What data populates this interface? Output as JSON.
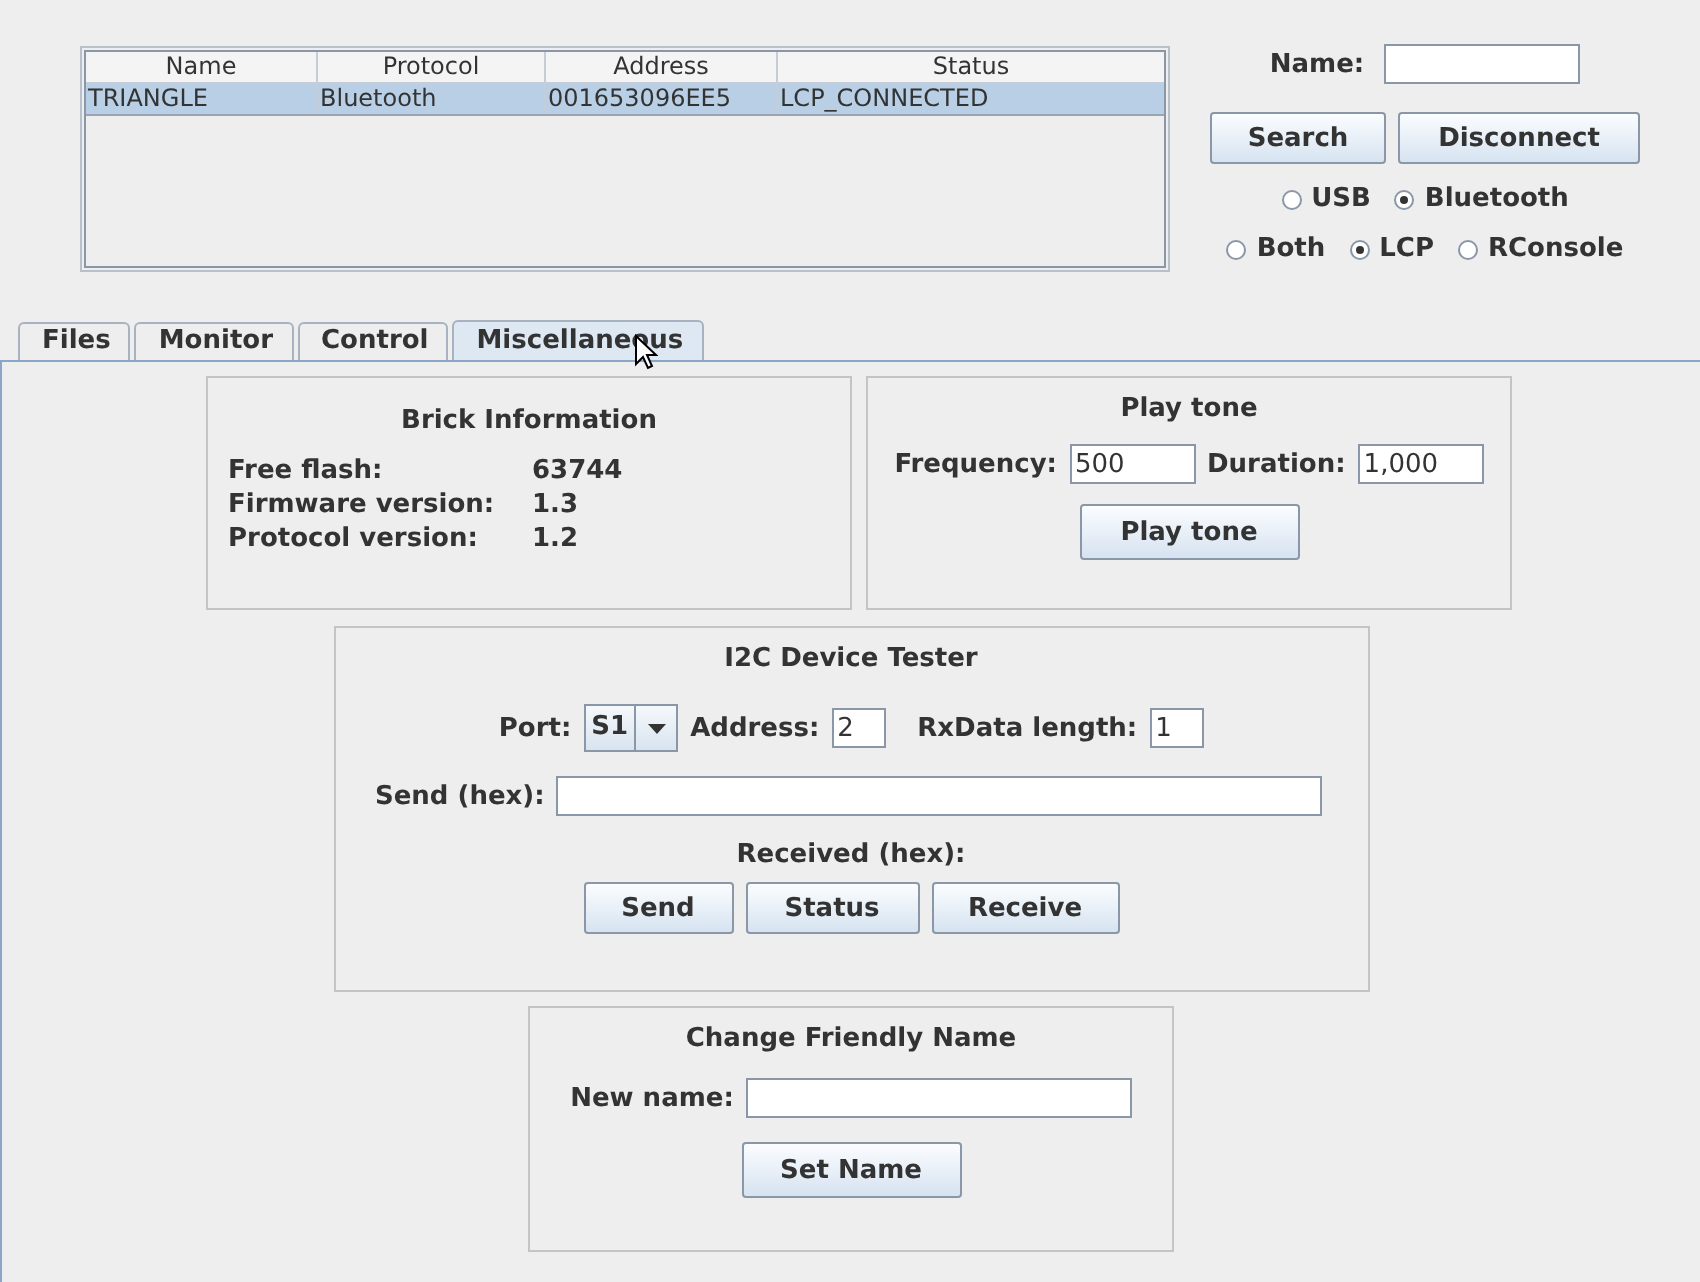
{
  "devices": {
    "columns": [
      "Name",
      "Protocol",
      "Address",
      "Status"
    ],
    "rows": [
      {
        "cells": [
          "TRIANGLE",
          "Bluetooth",
          "001653096EE5",
          "LCP_CONNECTED"
        ],
        "selected": true
      }
    ]
  },
  "connect": {
    "name_label": "Name:",
    "buttons": [
      "Search",
      "Disconnect"
    ],
    "transport": [
      {
        "label": "USB",
        "selected": false
      },
      {
        "label": "Bluetooth",
        "selected": true
      }
    ],
    "protocol": [
      {
        "label": "Both",
        "selected": false
      },
      {
        "label": "LCP",
        "selected": true
      },
      {
        "label": "RConsole",
        "selected": false
      }
    ]
  },
  "tabs": [
    {
      "label": "Files",
      "selected": false
    },
    {
      "label": "Monitor",
      "selected": false
    },
    {
      "label": "Control",
      "selected": false
    },
    {
      "label": "Miscellaneous",
      "selected": true
    }
  ],
  "brick_info": {
    "title": "Brick Information",
    "rows": [
      {
        "label": "Free flash:",
        "value": "63744"
      },
      {
        "label": "Firmware version:",
        "value": "1.3"
      },
      {
        "label": "Protocol version:",
        "value": "1.2"
      }
    ]
  },
  "play_tone": {
    "title": "Play tone",
    "fields": [
      {
        "label": "Frequency:",
        "value": "500"
      },
      {
        "label": "Duration:",
        "value": "1,000"
      }
    ],
    "button": "Play tone"
  },
  "i2c": {
    "title": "I2C Device Tester",
    "port": {
      "label": "Port:",
      "value": "S1"
    },
    "address": {
      "label": "Address:",
      "value": "2"
    },
    "rx_length": {
      "label": "RxData length:",
      "value": "1"
    },
    "send_label": "Send (hex):",
    "received_label": "Received (hex):",
    "buttons": [
      "Send",
      "Status",
      "Receive"
    ]
  },
  "friendly_name": {
    "title": "Change Friendly Name",
    "label": "New name:",
    "button": "Set Name"
  }
}
